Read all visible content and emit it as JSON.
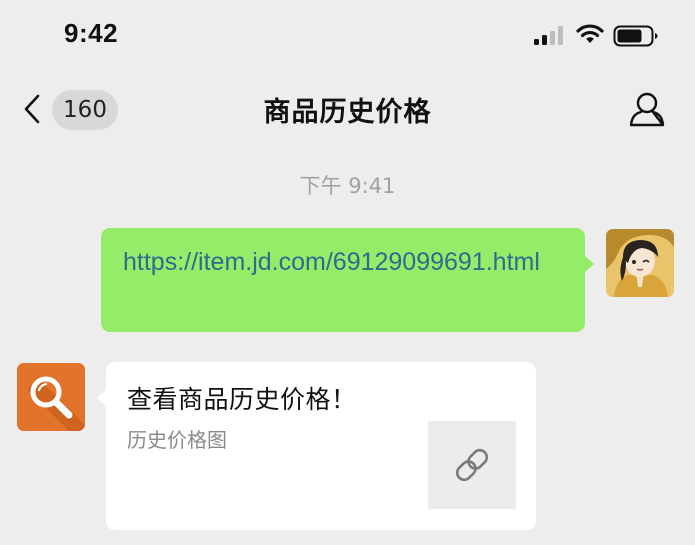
{
  "status_bar": {
    "time": "9:42"
  },
  "nav": {
    "unread_count": "160",
    "title": "商品历史价格"
  },
  "chat": {
    "timestamp": "下午 9:41",
    "messages": [
      {
        "direction": "outgoing",
        "type": "text",
        "text": "https://item.jd.com/69129099691.html"
      },
      {
        "direction": "incoming",
        "type": "link-card",
        "title": "查看商品历史价格！",
        "description": "历史价格图"
      }
    ]
  },
  "colors": {
    "background": "#ededed",
    "outgoing_bubble": "#95ec69",
    "incoming_bubble": "#ffffff",
    "link_text": "#2f6a90",
    "bot_avatar": "#e2732a"
  },
  "icons": {
    "signal": "cellular-signal-icon",
    "wifi": "wifi-icon",
    "battery": "battery-icon",
    "back": "chevron-left-icon",
    "profile": "person-icon",
    "bot_avatar": "magnifier-icon",
    "card_thumbnail": "link-icon"
  }
}
